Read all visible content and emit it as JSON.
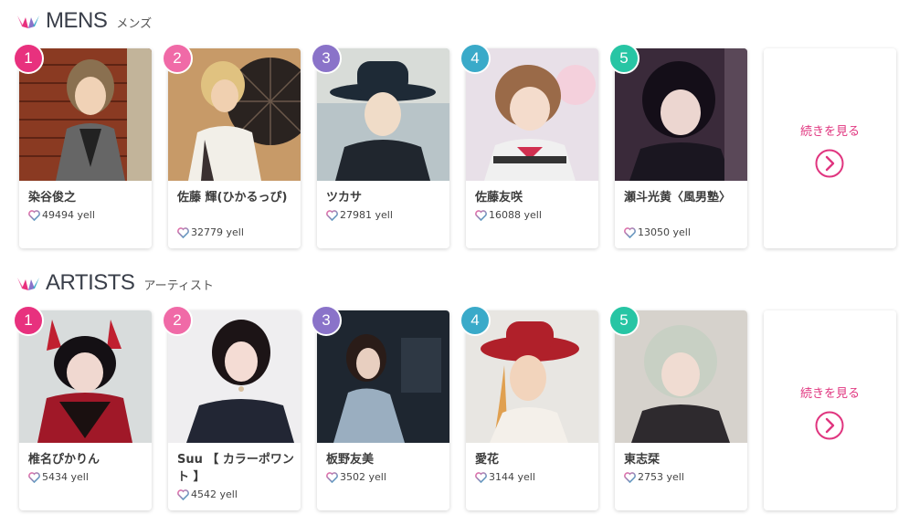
{
  "colors": {
    "pink": "#e0357f",
    "rank1": "#e8317e",
    "rank2": "#f06aa7",
    "rank3": "#8a73c9",
    "rank4": "#3aaac9",
    "rank5": "#27c5a4"
  },
  "mens": {
    "title": "MENS",
    "subtitle": "メンズ",
    "more_label": "続きを見る",
    "cards": [
      {
        "rank": "1",
        "name": "染谷俊之",
        "yell": "49494 yell",
        "icon": "heart-icon"
      },
      {
        "rank": "2",
        "name": "佐藤 輝(ひかるっぴ)",
        "yell": "32779 yell",
        "icon": "heart-icon"
      },
      {
        "rank": "3",
        "name": "ツカサ",
        "yell": "27981 yell",
        "icon": "heart-icon"
      },
      {
        "rank": "4",
        "name": "佐藤友咲",
        "yell": "16088 yell",
        "icon": "heart-icon"
      },
      {
        "rank": "5",
        "name": "瀬斗光黄〈風男塾〉",
        "yell": "13050 yell",
        "icon": "heart-icon"
      }
    ]
  },
  "artists": {
    "title": "ARTISTS",
    "subtitle": "アーティスト",
    "more_label": "続きを見る",
    "cards": [
      {
        "rank": "1",
        "name": "椎名ぴかりん",
        "yell": "5434 yell",
        "icon": "heart-icon"
      },
      {
        "rank": "2",
        "name": "Suu 【 カラーポワント 】",
        "yell": "4542 yell",
        "icon": "heart-icon"
      },
      {
        "rank": "3",
        "name": "板野友美",
        "yell": "3502 yell",
        "icon": "heart-icon"
      },
      {
        "rank": "4",
        "name": "愛花",
        "yell": "3144 yell",
        "icon": "heart-icon"
      },
      {
        "rank": "5",
        "name": "東志栞",
        "yell": "2753 yell",
        "icon": "heart-icon"
      }
    ]
  }
}
